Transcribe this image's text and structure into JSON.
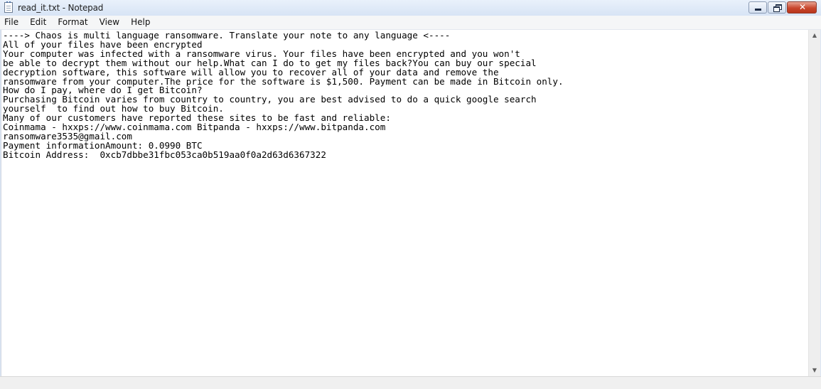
{
  "window": {
    "title": "read_it.txt - Notepad",
    "app_icon": "notepad-icon",
    "caption_buttons": [
      "minimize-icon",
      "restore-icon",
      "close-icon"
    ],
    "close_color": "#c8472e"
  },
  "menu": {
    "items": [
      "File",
      "Edit",
      "Format",
      "View",
      "Help"
    ]
  },
  "editor": {
    "lines": [
      "----> Chaos is multi language ransomware. Translate your note to any language <----",
      "All of your files have been encrypted",
      "Your computer was infected with a ransomware virus. Your files have been encrypted and you won't",
      "be able to decrypt them without our help.What can I do to get my files back?You can buy our special",
      "decryption software, this software will allow you to recover all of your data and remove the",
      "ransomware from your computer.The price for the software is $1,500. Payment can be made in Bitcoin only.",
      "How do I pay, where do I get Bitcoin?",
      "Purchasing Bitcoin varies from country to country, you are best advised to do a quick google search",
      "yourself  to find out how to buy Bitcoin.",
      "Many of our customers have reported these sites to be fast and reliable:",
      "Coinmama - hxxps://www.coinmama.com Bitpanda - hxxps://www.bitpanda.com",
      "ransomware3535@gmail.com",
      "Payment informationAmount: 0.0990 BTC",
      "Bitcoin Address:  0xcb7dbbe31fbc053ca0b519aa0f0a2d63d6367322"
    ]
  },
  "scrollbar": {
    "up_arrow": "▲",
    "down_arrow": "▼"
  }
}
